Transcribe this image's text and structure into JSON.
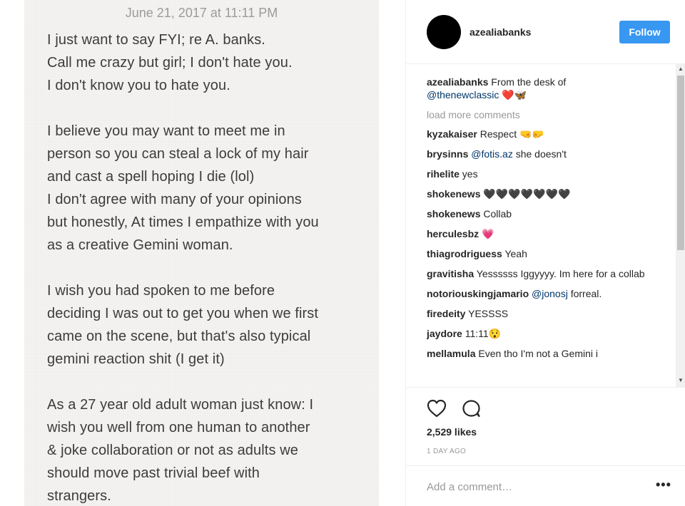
{
  "note": {
    "date": "June 21, 2017 at 11:11 PM",
    "paragraphs": [
      [
        "I just want to say FYI; re A. banks.",
        "Call me crazy but girl; I don't hate you.",
        "I don't know you to hate you."
      ],
      [
        "I believe you may want to meet me in",
        "person so you can steal a lock of my hair",
        "and cast a spell hoping I die (lol)",
        "I don't agree with many of your opinions",
        "but honestly, At times I empathize with you",
        "as a creative Gemini woman."
      ],
      [
        "I wish you had spoken to me before",
        "deciding I was out to get you when we first",
        "came on the scene, but that's also typical",
        "gemini reaction shit (I get it)"
      ],
      [
        "As a 27 year old adult woman just know: I",
        "wish you well from one human to another",
        "& joke collaboration or not as adults we",
        "should move past trivial beef with",
        "strangers."
      ]
    ]
  },
  "header": {
    "username": "azealiabanks",
    "follow_label": "Follow"
  },
  "caption": {
    "username": "azealiabanks",
    "text": "From the desk of",
    "mention": "@thenewclassic",
    "emoji": "❤️🦋"
  },
  "load_more": "load more comments",
  "comments": [
    {
      "user": "kyzakaiser",
      "text": "Respect 🤜🤛"
    },
    {
      "user": "brysinns",
      "mention": "@fotis.az",
      "text": "she doesn't"
    },
    {
      "user": "rihelite",
      "text": "yes"
    },
    {
      "user": "shokenews",
      "text": "🖤🖤🖤🖤🖤🖤🖤"
    },
    {
      "user": "shokenews",
      "text": "Collab"
    },
    {
      "user": "herculesbz",
      "text": "💗"
    },
    {
      "user": "thiagrodriguess",
      "text": "Yeah"
    },
    {
      "user": "gravitisha",
      "text": "Yessssss Iggyyyy. Im here for a collab"
    },
    {
      "user": "notoriouskingjamario",
      "mention": "@jonosj",
      "text": "forreal."
    },
    {
      "user": "firedeity",
      "text": "YESSSS"
    },
    {
      "user": "jaydore",
      "text": "11:11😯"
    },
    {
      "user": "mellamula",
      "text": "Even tho I'm not a Gemini i"
    }
  ],
  "likes": "2,529 likes",
  "time_ago": "1 DAY AGO",
  "add_comment_placeholder": "Add a comment…",
  "more_label": "•••",
  "colors": {
    "follow_bg": "#3897f0",
    "mention": "#003569",
    "muted": "#999999"
  },
  "icons": [
    "heart-icon",
    "comment-icon",
    "more-options-icon"
  ]
}
